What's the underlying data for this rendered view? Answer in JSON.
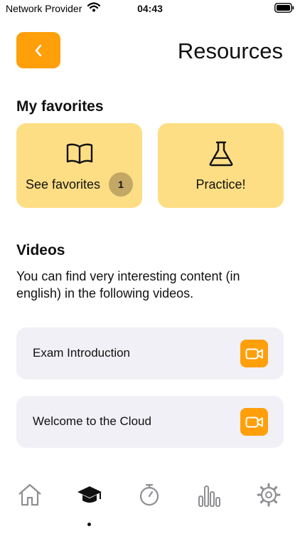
{
  "status_bar": {
    "carrier": "Network Provider",
    "time": "04:43"
  },
  "header": {
    "title": "Resources",
    "back_icon": "chevron-left-icon"
  },
  "favorites": {
    "title": "My favorites",
    "cards": [
      {
        "label": "See favorites",
        "icon": "book-icon",
        "badge": "1"
      },
      {
        "label": "Practice!",
        "icon": "flask-icon"
      }
    ]
  },
  "videos": {
    "title": "Videos",
    "description": "You can find very interesting content (in english) in the following videos.",
    "items": [
      {
        "title": "Exam Introduction",
        "icon": "video-camera-icon"
      },
      {
        "title": "Welcome to the Cloud",
        "icon": "video-camera-icon"
      }
    ]
  },
  "tab_bar": {
    "items": [
      {
        "icon": "home-icon"
      },
      {
        "icon": "graduation-cap-icon",
        "selected": true
      },
      {
        "icon": "stopwatch-icon"
      },
      {
        "icon": "bar-chart-icon"
      },
      {
        "icon": "gear-icon"
      }
    ]
  },
  "colors": {
    "accent": "#ff9f0a",
    "card": "#fede84",
    "badge": "#c2a765",
    "row": "#f0f0f6",
    "inactive_icon": "#8e8e93"
  }
}
